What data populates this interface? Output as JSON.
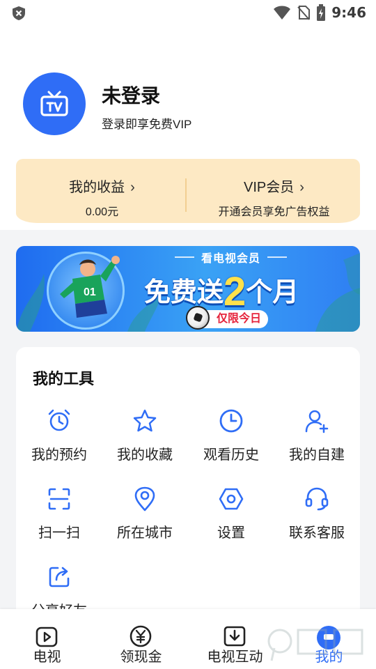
{
  "status_bar": {
    "time": "9:46",
    "icons": [
      "shield-icon",
      "wifi-icon",
      "no-sim-icon",
      "battery-charging-icon"
    ]
  },
  "profile": {
    "name": "未登录",
    "subtitle": "登录即享免费VIP",
    "avatar_icon": "tv-icon"
  },
  "benefits": {
    "earnings": {
      "title": "我的收益",
      "value": "0.00元"
    },
    "vip": {
      "title": "VIP会员",
      "desc": "开通会员享免广告权益"
    }
  },
  "banner": {
    "tag": "看电视会员",
    "headline_pre": "免费送",
    "headline_num": "2",
    "headline_post": "个月",
    "limit": "仅限今日",
    "jersey_text": "01"
  },
  "tools": {
    "title": "我的工具",
    "items": [
      {
        "label": "我的预约",
        "icon": "alarm-clock-icon"
      },
      {
        "label": "我的收藏",
        "icon": "star-icon"
      },
      {
        "label": "观看历史",
        "icon": "clock-icon"
      },
      {
        "label": "我的自建",
        "icon": "add-user-icon"
      },
      {
        "label": "扫一扫",
        "icon": "scan-icon"
      },
      {
        "label": "所在城市",
        "icon": "location-pin-icon"
      },
      {
        "label": "设置",
        "icon": "settings-hexagon-icon"
      },
      {
        "label": "联系客服",
        "icon": "headset-icon"
      },
      {
        "label": "分享好友",
        "icon": "share-icon"
      }
    ]
  },
  "bottom_nav": {
    "items": [
      {
        "label": "电视",
        "icon": "play-tv-icon"
      },
      {
        "label": "领现金",
        "icon": "yuan-coin-icon"
      },
      {
        "label": "电视互动",
        "icon": "download-tv-icon"
      },
      {
        "label": "我的",
        "icon": "profile-icon"
      }
    ],
    "active_index": 3
  },
  "colors": {
    "accent": "#2f6df6",
    "benefit_bg": "#fde9c4",
    "banner_yellow": "#ffe14a",
    "limit_red": "#e5233b"
  }
}
